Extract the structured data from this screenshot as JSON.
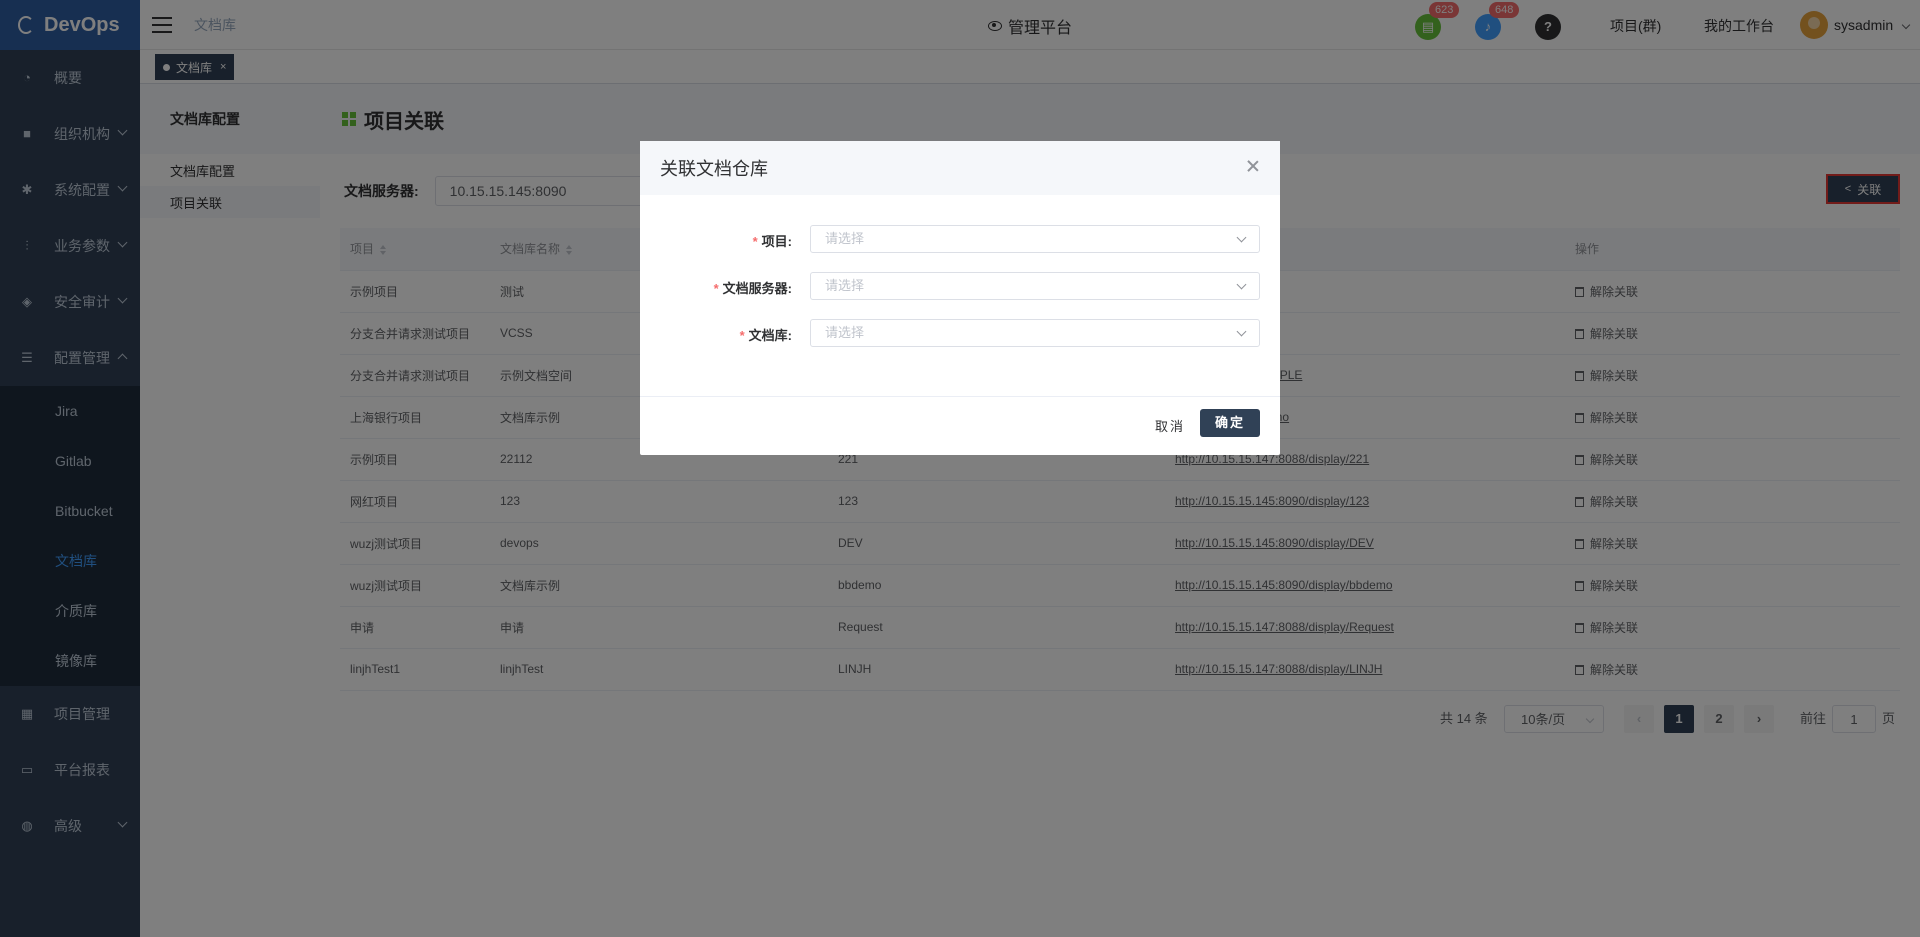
{
  "app": {
    "brand": "DevOps"
  },
  "sidebar": {
    "items": [
      {
        "label": "概要",
        "icon": "dashboard-icon"
      },
      {
        "label": "组织机构",
        "icon": "lock-icon"
      },
      {
        "label": "系统配置",
        "icon": "gear-icon"
      },
      {
        "label": "业务参数",
        "icon": "sliders-icon"
      },
      {
        "label": "安全审计",
        "icon": "shield-icon"
      },
      {
        "label": "配置管理",
        "icon": "database-icon"
      }
    ],
    "submenu": [
      "Jira",
      "Gitlab",
      "Bitbucket",
      "文档库",
      "介质库",
      "镜像库"
    ],
    "items_after": [
      {
        "label": "项目管理",
        "icon": "grid-icon"
      },
      {
        "label": "平台报表",
        "icon": "monitor-icon"
      },
      {
        "label": "高级",
        "icon": "palette-icon"
      }
    ],
    "active_sub": "文档库"
  },
  "header": {
    "breadcrumb": "文档库",
    "platform": "管理平台",
    "badge_tasks": "623",
    "badge_notices": "648",
    "help": "?",
    "link_projects": "项目(群)",
    "link_workbench": "我的工作台",
    "username": "sysadmin"
  },
  "tags": {
    "active": "文档库",
    "close": "×"
  },
  "subside": {
    "title": "文档库配置",
    "items": [
      "文档库配置",
      "项目关联"
    ]
  },
  "page": {
    "title": "项目关联",
    "filter_label": "文档服务器:",
    "filter_value": "10.15.15.145:8090",
    "assoc_button": "关联"
  },
  "table": {
    "headers": [
      "项目",
      "文档库名称",
      "",
      "",
      "操作"
    ],
    "action_label": "解除关联",
    "rows": [
      [
        "示例项目",
        "测试",
        "",
        "8088/display/test"
      ],
      [
        "分支合并请求测试项目",
        "VCSS",
        "",
        "8090/display/VCSS"
      ],
      [
        "分支合并请求测试项目",
        "示例文档空间",
        "",
        "8090/display/EXAMPLE"
      ],
      [
        "上海银行项目",
        "文档库示例",
        "",
        "8090/display/bbdemo"
      ],
      [
        "示例项目",
        "22112",
        "221",
        "http://10.15.15.147:8088/display/221"
      ],
      [
        "网红项目",
        "123",
        "123",
        "http://10.15.15.145:8090/display/123"
      ],
      [
        "wuzj测试项目",
        "devops",
        "DEV",
        "http://10.15.15.145:8090/display/DEV"
      ],
      [
        "wuzj测试项目",
        "文档库示例",
        "bbdemo",
        "http://10.15.15.145:8090/display/bbdemo"
      ],
      [
        "申请",
        "申请",
        "Request",
        "http://10.15.15.147:8088/display/Request"
      ],
      [
        "linjhTest1",
        "linjhTest",
        "LINJH",
        "http://10.15.15.147:8088/display/LINJH"
      ]
    ]
  },
  "pager": {
    "total": "共 14 条",
    "size": "10条/页",
    "prev": "‹",
    "next": "›",
    "pages": [
      "1",
      "2"
    ],
    "goto": "前往",
    "goto_value": "1",
    "goto_unit": "页"
  },
  "dialog": {
    "title": "关联文档仓库",
    "fields": [
      {
        "label": "项目:",
        "placeholder": "请选择"
      },
      {
        "label": "文档服务器:",
        "placeholder": "请选择"
      },
      {
        "label": "文档库:",
        "placeholder": "请选择"
      }
    ],
    "required_mark": "*",
    "cancel": "取消",
    "ok": "确定"
  },
  "colors": {
    "sidebar": "#304156",
    "brand": "#2f5ea3",
    "accent": "#409eff",
    "danger": "#f56c6c"
  }
}
